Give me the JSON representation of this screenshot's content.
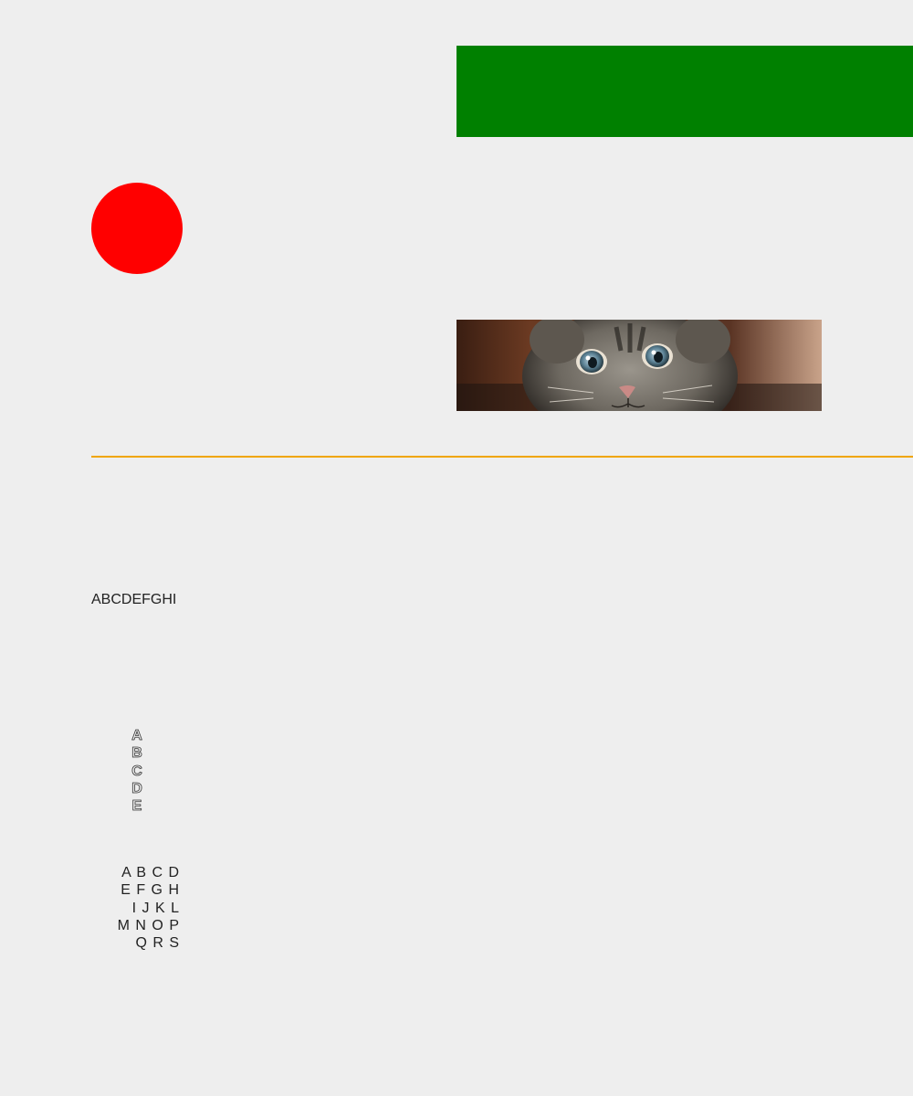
{
  "colors": {
    "background": "#eeeeee",
    "green_bar": "#008000",
    "red_circle": "#ff0000",
    "orange_rule": "#f0a500"
  },
  "text": {
    "abc_line": "ABCDEFGHI",
    "vertical_letters": [
      "A",
      "B",
      "C",
      "D",
      "E"
    ],
    "letter_grid_rows": [
      "A B C D",
      "E F G H",
      "I J K L",
      "M N O P",
      "Q R S"
    ]
  }
}
